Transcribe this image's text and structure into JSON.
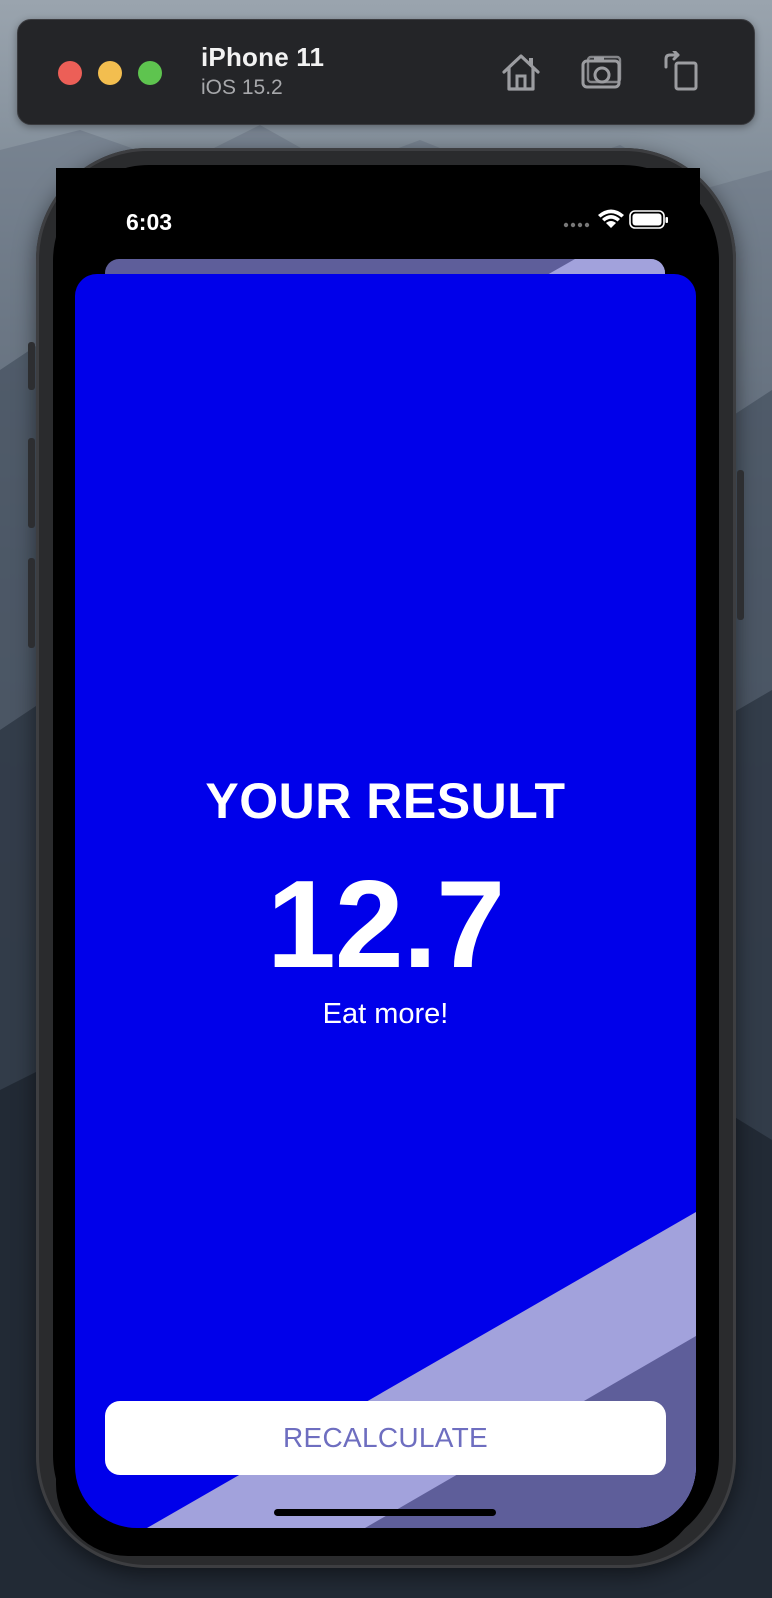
{
  "simulator": {
    "device_name": "iPhone 11",
    "os_version": "iOS 15.2",
    "toolbar_icons": [
      "home-icon",
      "screenshot-icon",
      "rotate-icon"
    ]
  },
  "status_bar": {
    "time": "6:03",
    "icons": [
      "cellular-signal-icon",
      "wifi-icon",
      "battery-icon"
    ]
  },
  "result_screen": {
    "title": "YOUR RESULT",
    "bmi_value": "12.7",
    "message": "Eat more!",
    "recalculate_label": "RECALCULATE"
  },
  "colors": {
    "card_background": "#0000ea",
    "accent_light": "#a2a2dc",
    "accent_dark": "#5e5e9a",
    "button_text": "#6e6ec0"
  }
}
